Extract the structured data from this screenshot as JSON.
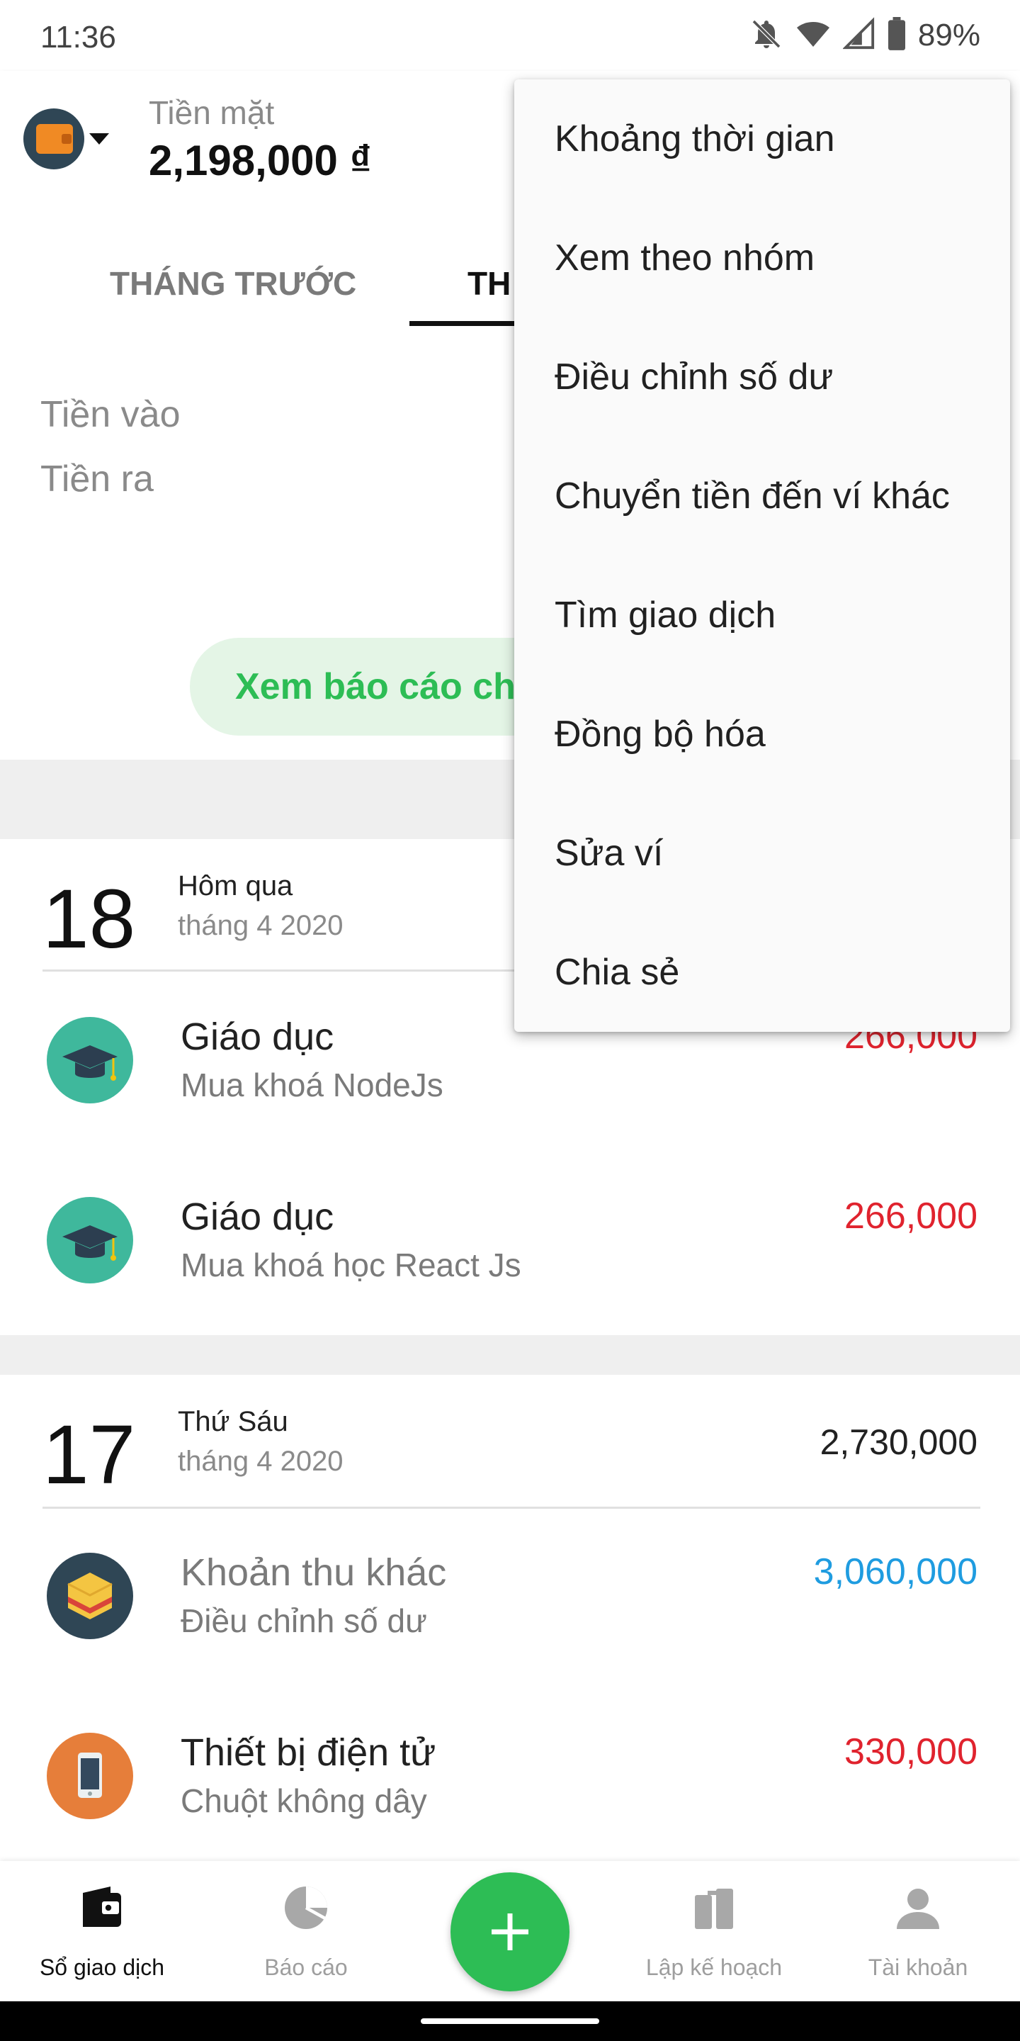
{
  "status_bar": {
    "time": "11:36",
    "battery": "89%"
  },
  "header": {
    "wallet_name": "Tiền mặt",
    "wallet_balance": "2,198,000 ₫",
    "tabs": [
      {
        "label": "THÁNG TRƯỚC"
      },
      {
        "label": "TH"
      }
    ]
  },
  "summary": {
    "income_label": "Tiền vào",
    "expense_label": "Tiền ra",
    "report_button": "Xem báo cáo ch"
  },
  "days": [
    {
      "date": "18",
      "title": "Hôm qua",
      "subtitle": "tháng 4 2020",
      "total": "",
      "transactions": [
        {
          "category": "Giáo dục",
          "note": "Mua khoá NodeJs",
          "amount": "266,000",
          "type": "expense",
          "icon": "graduation-cap-icon"
        },
        {
          "category": "Giáo dục",
          "note": "Mua khoá học React Js",
          "amount": "266,000",
          "type": "expense",
          "icon": "graduation-cap-icon"
        }
      ]
    },
    {
      "date": "17",
      "title": "Thứ Sáu",
      "subtitle": "tháng 4 2020",
      "total": "2,730,000",
      "transactions": [
        {
          "category": "Khoản thu khác",
          "note": "Điều chỉnh số dư",
          "amount": "3,060,000",
          "type": "income",
          "icon": "box-icon"
        },
        {
          "category": "Thiết bị điện tử",
          "note": "Chuột không dây",
          "amount": "330,000",
          "type": "expense",
          "icon": "phone-icon"
        }
      ]
    }
  ],
  "bottom_nav": [
    {
      "label": "Sổ giao dịch",
      "icon": "wallet-icon",
      "active": true
    },
    {
      "label": "Báo cáo",
      "icon": "pie-chart-icon",
      "active": false
    },
    {
      "label": "Lập kế hoạch",
      "icon": "planning-icon",
      "active": false
    },
    {
      "label": "Tài khoản",
      "icon": "person-icon",
      "active": false
    }
  ],
  "menu": {
    "items": [
      "Khoảng thời gian",
      "Xem theo nhóm",
      "Điều chỉnh số dư",
      "Chuyển tiền đến ví khác",
      "Tìm giao dịch",
      "Đồng bộ hóa",
      "Sửa ví",
      "Chia sẻ"
    ]
  },
  "colors": {
    "accent_green": "#2dbd55",
    "expense_red": "#e0232e",
    "income_blue": "#1f9ce0"
  }
}
